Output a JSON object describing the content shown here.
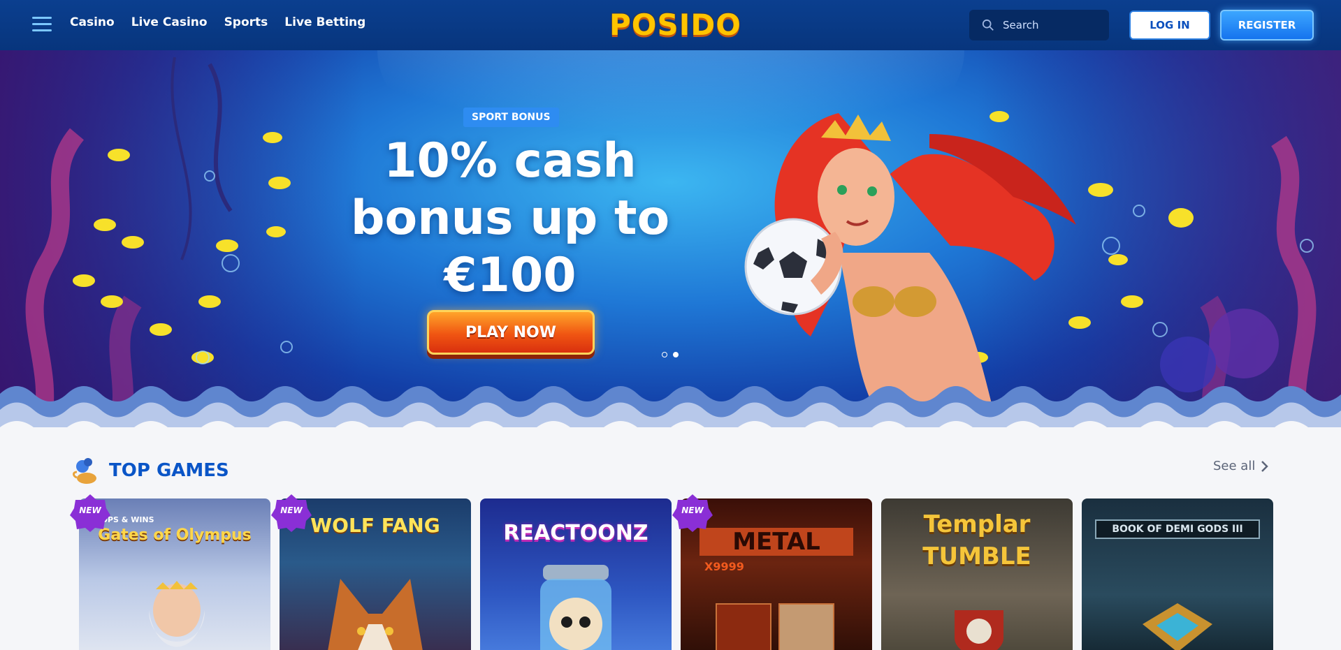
{
  "header": {
    "nav": [
      "Casino",
      "Live Casino",
      "Sports",
      "Live Betting"
    ],
    "logo": "POSIDO",
    "search_placeholder": "Search",
    "login_label": "LOG IN",
    "register_label": "REGISTER"
  },
  "hero": {
    "badge": "SPORT BONUS",
    "headline_line1": "10% cash",
    "headline_line2": "bonus up to",
    "headline_line3": "€100",
    "cta": "PLAY NOW",
    "slide_count": 2,
    "active_slide": 2
  },
  "top_games": {
    "title": "TOP GAMES",
    "see_all": "See all",
    "games": [
      {
        "title": "Gates of Olympus",
        "is_new": true,
        "new_label": "NEW",
        "extra": "DROPS & WINS"
      },
      {
        "title": "WOLF FANG",
        "is_new": true,
        "new_label": "NEW"
      },
      {
        "title": "REACTOONZ",
        "is_new": false
      },
      {
        "title": "METAL",
        "is_new": true,
        "new_label": "NEW",
        "extra": "X9999"
      },
      {
        "title": "Templar TUMBLE",
        "is_new": false
      },
      {
        "title": "BOOK OF DEMI GODS III",
        "is_new": false
      }
    ]
  },
  "colors": {
    "header_bg": "#0b3f8f",
    "accent_blue": "#2e8cf1",
    "title_blue": "#0a55c7",
    "cta_orange": "#f05512",
    "logo_yellow": "#ffc400"
  }
}
